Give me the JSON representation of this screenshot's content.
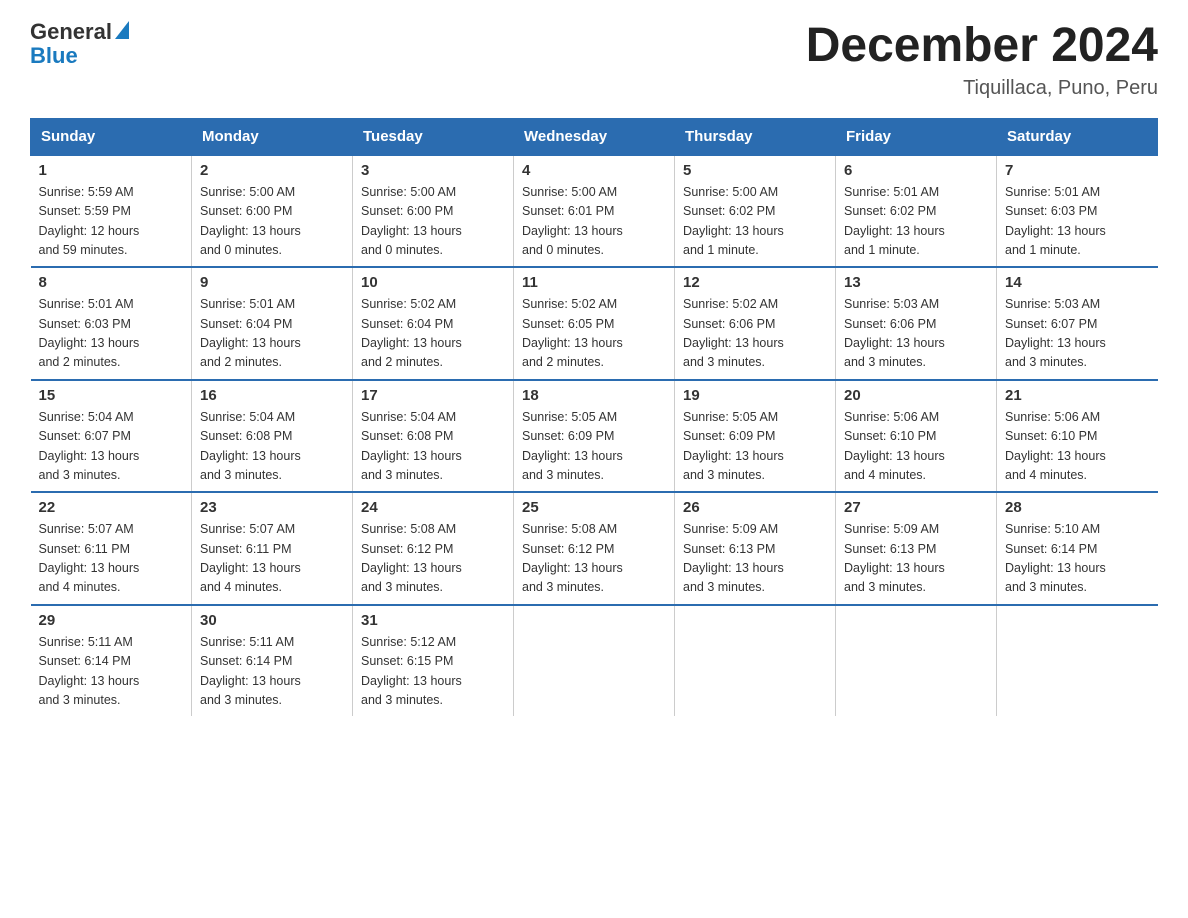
{
  "header": {
    "logo_line1": "General",
    "logo_line2": "Blue",
    "title": "December 2024",
    "subtitle": "Tiquillaca, Puno, Peru"
  },
  "days_of_week": [
    "Sunday",
    "Monday",
    "Tuesday",
    "Wednesday",
    "Thursday",
    "Friday",
    "Saturday"
  ],
  "weeks": [
    [
      {
        "day": "1",
        "sunrise": "5:59 AM",
        "sunset": "5:59 PM",
        "daylight": "12 hours and 59 minutes."
      },
      {
        "day": "2",
        "sunrise": "5:00 AM",
        "sunset": "6:00 PM",
        "daylight": "13 hours and 0 minutes."
      },
      {
        "day": "3",
        "sunrise": "5:00 AM",
        "sunset": "6:00 PM",
        "daylight": "13 hours and 0 minutes."
      },
      {
        "day": "4",
        "sunrise": "5:00 AM",
        "sunset": "6:01 PM",
        "daylight": "13 hours and 0 minutes."
      },
      {
        "day": "5",
        "sunrise": "5:00 AM",
        "sunset": "6:02 PM",
        "daylight": "13 hours and 1 minute."
      },
      {
        "day": "6",
        "sunrise": "5:01 AM",
        "sunset": "6:02 PM",
        "daylight": "13 hours and 1 minute."
      },
      {
        "day": "7",
        "sunrise": "5:01 AM",
        "sunset": "6:03 PM",
        "daylight": "13 hours and 1 minute."
      }
    ],
    [
      {
        "day": "8",
        "sunrise": "5:01 AM",
        "sunset": "6:03 PM",
        "daylight": "13 hours and 2 minutes."
      },
      {
        "day": "9",
        "sunrise": "5:01 AM",
        "sunset": "6:04 PM",
        "daylight": "13 hours and 2 minutes."
      },
      {
        "day": "10",
        "sunrise": "5:02 AM",
        "sunset": "6:04 PM",
        "daylight": "13 hours and 2 minutes."
      },
      {
        "day": "11",
        "sunrise": "5:02 AM",
        "sunset": "6:05 PM",
        "daylight": "13 hours and 2 minutes."
      },
      {
        "day": "12",
        "sunrise": "5:02 AM",
        "sunset": "6:06 PM",
        "daylight": "13 hours and 3 minutes."
      },
      {
        "day": "13",
        "sunrise": "5:03 AM",
        "sunset": "6:06 PM",
        "daylight": "13 hours and 3 minutes."
      },
      {
        "day": "14",
        "sunrise": "5:03 AM",
        "sunset": "6:07 PM",
        "daylight": "13 hours and 3 minutes."
      }
    ],
    [
      {
        "day": "15",
        "sunrise": "5:04 AM",
        "sunset": "6:07 PM",
        "daylight": "13 hours and 3 minutes."
      },
      {
        "day": "16",
        "sunrise": "5:04 AM",
        "sunset": "6:08 PM",
        "daylight": "13 hours and 3 minutes."
      },
      {
        "day": "17",
        "sunrise": "5:04 AM",
        "sunset": "6:08 PM",
        "daylight": "13 hours and 3 minutes."
      },
      {
        "day": "18",
        "sunrise": "5:05 AM",
        "sunset": "6:09 PM",
        "daylight": "13 hours and 3 minutes."
      },
      {
        "day": "19",
        "sunrise": "5:05 AM",
        "sunset": "6:09 PM",
        "daylight": "13 hours and 3 minutes."
      },
      {
        "day": "20",
        "sunrise": "5:06 AM",
        "sunset": "6:10 PM",
        "daylight": "13 hours and 4 minutes."
      },
      {
        "day": "21",
        "sunrise": "5:06 AM",
        "sunset": "6:10 PM",
        "daylight": "13 hours and 4 minutes."
      }
    ],
    [
      {
        "day": "22",
        "sunrise": "5:07 AM",
        "sunset": "6:11 PM",
        "daylight": "13 hours and 4 minutes."
      },
      {
        "day": "23",
        "sunrise": "5:07 AM",
        "sunset": "6:11 PM",
        "daylight": "13 hours and 4 minutes."
      },
      {
        "day": "24",
        "sunrise": "5:08 AM",
        "sunset": "6:12 PM",
        "daylight": "13 hours and 3 minutes."
      },
      {
        "day": "25",
        "sunrise": "5:08 AM",
        "sunset": "6:12 PM",
        "daylight": "13 hours and 3 minutes."
      },
      {
        "day": "26",
        "sunrise": "5:09 AM",
        "sunset": "6:13 PM",
        "daylight": "13 hours and 3 minutes."
      },
      {
        "day": "27",
        "sunrise": "5:09 AM",
        "sunset": "6:13 PM",
        "daylight": "13 hours and 3 minutes."
      },
      {
        "day": "28",
        "sunrise": "5:10 AM",
        "sunset": "6:14 PM",
        "daylight": "13 hours and 3 minutes."
      }
    ],
    [
      {
        "day": "29",
        "sunrise": "5:11 AM",
        "sunset": "6:14 PM",
        "daylight": "13 hours and 3 minutes."
      },
      {
        "day": "30",
        "sunrise": "5:11 AM",
        "sunset": "6:14 PM",
        "daylight": "13 hours and 3 minutes."
      },
      {
        "day": "31",
        "sunrise": "5:12 AM",
        "sunset": "6:15 PM",
        "daylight": "13 hours and 3 minutes."
      },
      null,
      null,
      null,
      null
    ]
  ]
}
